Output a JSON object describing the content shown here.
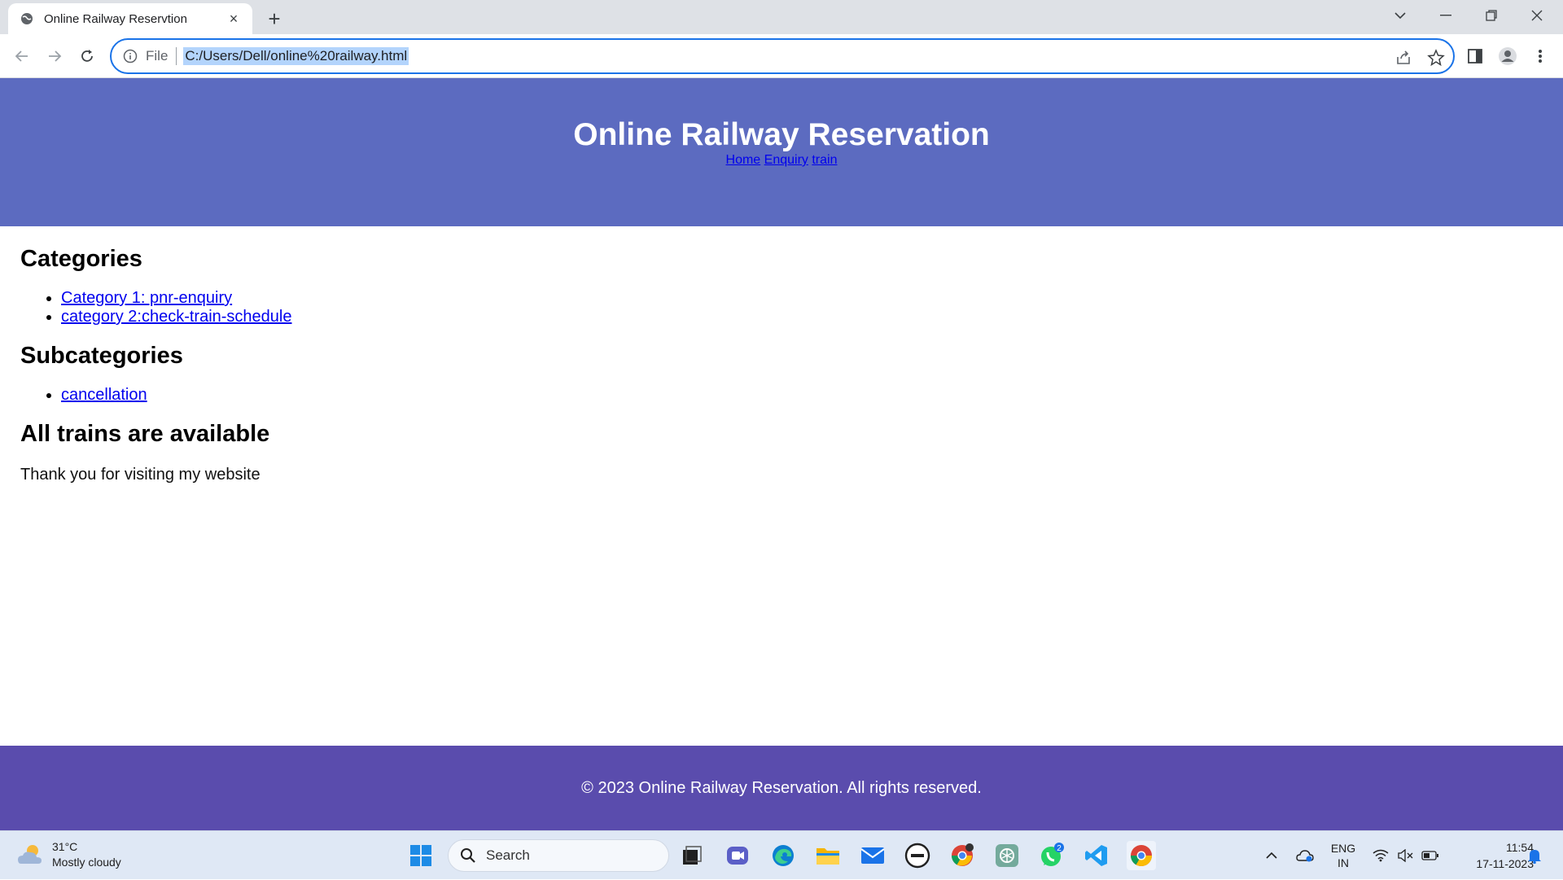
{
  "browser": {
    "tab_title": "Online Railway Reservtion",
    "address": {
      "scheme": "File",
      "url": "C:/Users/Dell/online%20railway.html"
    }
  },
  "site": {
    "title": "Online Railway Reservation",
    "nav": [
      "Home",
      "Enquiry",
      "train"
    ],
    "sections": {
      "categories_heading": "Categories",
      "categories": [
        "Category 1: pnr-enquiry",
        "category 2:check-train-schedule"
      ],
      "subcategories_heading": "Subcategories",
      "subcategories": [
        "cancellation"
      ],
      "trains_heading": "All trains are available",
      "thanks": "Thank you for visiting my website"
    },
    "footer": "© 2023 Online Railway Reservation. All rights reserved.",
    "colors": {
      "header": "#5c6bc0",
      "footer": "#5a4cad",
      "link": "#0000ee"
    }
  },
  "taskbar": {
    "weather": {
      "temp": "31°C",
      "condition": "Mostly cloudy"
    },
    "search_label": "Search",
    "whatsapp_badge": "2",
    "lang_top": "ENG",
    "lang_bottom": "IN",
    "time": "11:54",
    "date": "17-11-2023"
  }
}
